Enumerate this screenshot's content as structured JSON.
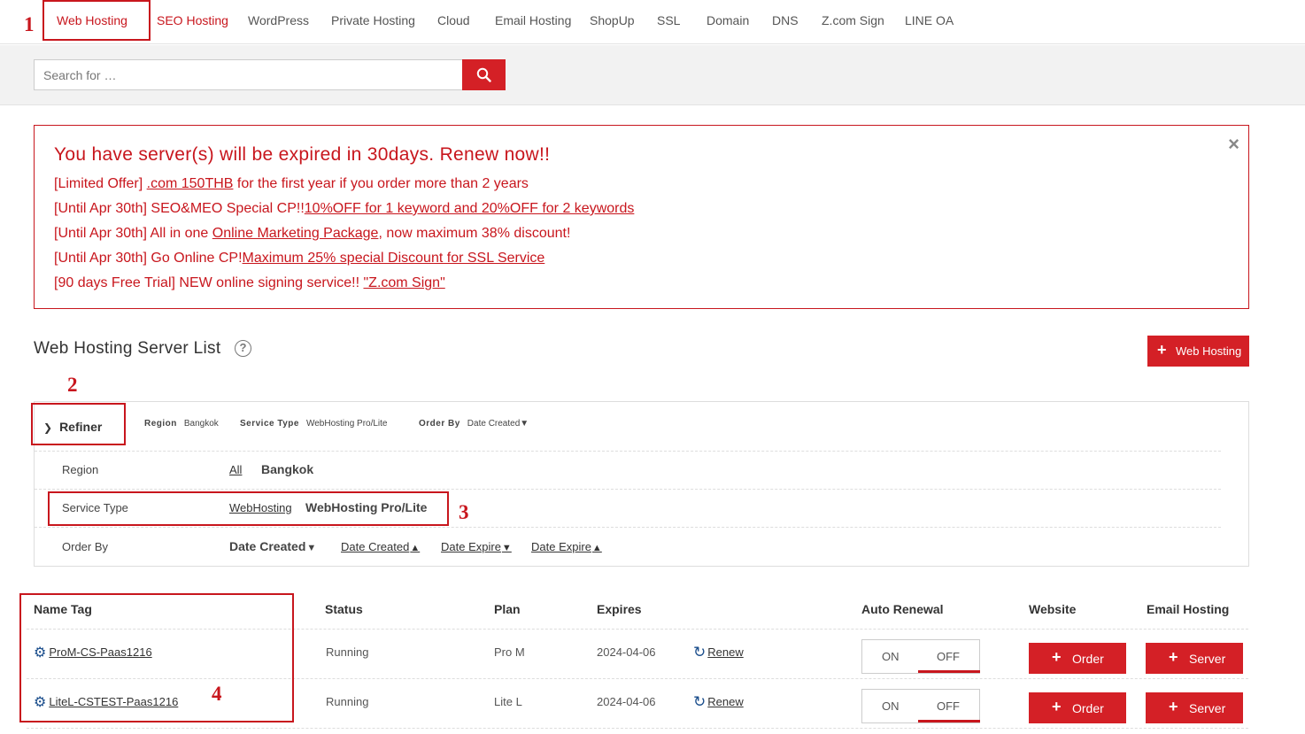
{
  "annotations": {
    "n1": "1",
    "n2": "2",
    "n3": "3",
    "n4": "4"
  },
  "nav": [
    {
      "label": "Web Hosting"
    },
    {
      "label": "SEO Hosting"
    },
    {
      "label": "WordPress"
    },
    {
      "label": "Private Hosting"
    },
    {
      "label": "Cloud"
    },
    {
      "label": "Email Hosting"
    },
    {
      "label": "ShopUp"
    },
    {
      "label": "SSL"
    },
    {
      "label": "Domain"
    },
    {
      "label": "DNS"
    },
    {
      "label": "Z.com Sign"
    },
    {
      "label": "LINE OA"
    }
  ],
  "search": {
    "placeholder": "Search for …"
  },
  "alert": {
    "title": "You have server(s) will be expired in 30days. Renew now!!",
    "close": "×",
    "lines": [
      {
        "prefix": "[Limited Offer] ",
        "link": ".com 150THB",
        "suffix": " for the first year if you order more than 2 years"
      },
      {
        "prefix": "[Until Apr 30th] SEO&MEO Special CP!!",
        "link": "10%OFF for 1 keyword and 20%OFF for 2 keywords",
        "suffix": ""
      },
      {
        "prefix": "[Until Apr 30th] All in one ",
        "link": "Online Marketing Package",
        "suffix": ", now maximum 38% discount!"
      },
      {
        "prefix": "[Until Apr 30th] Go Online CP!",
        "link": "Maximum 25% special Discount for SSL Service",
        "suffix": ""
      },
      {
        "prefix": "[90 days Free Trial] NEW online signing service!! ",
        "link": "\"Z.com Sign\"",
        "suffix": ""
      }
    ]
  },
  "section": {
    "title": "Web Hosting Server List",
    "help": "?",
    "add_button": "Web Hosting"
  },
  "refiner": {
    "toggle_label": "Refiner",
    "summary": [
      {
        "key": "Region",
        "value": "Bangkok"
      },
      {
        "key": "Service Type",
        "value": "WebHosting Pro/Lite"
      },
      {
        "key": "Order By",
        "value": "Date Created▼"
      }
    ],
    "rows": {
      "region": {
        "label": "Region",
        "options": [
          "All",
          "Bangkok"
        ]
      },
      "service_type": {
        "label": "Service Type",
        "options": [
          "WebHosting",
          "WebHosting Pro/Lite"
        ]
      },
      "order_by": {
        "label": "Order By",
        "options": [
          "Date Created",
          "Date Created",
          "Date Expire",
          "Date Expire"
        ]
      }
    }
  },
  "table": {
    "headers": [
      "Name Tag",
      "Status",
      "Plan",
      "Expires",
      "Auto Renewal",
      "Website",
      "Email Hosting"
    ],
    "renew_label": "Renew",
    "toggle_on": "ON",
    "toggle_off": "OFF",
    "order_label": "Order",
    "server_label": "Server",
    "rows": [
      {
        "name": "ProM-CS-Paas1216",
        "status": "Running",
        "plan": "Pro M",
        "expires": "2024-04-06",
        "auto_renewal": "OFF"
      },
      {
        "name": "LiteL-CSTEST-Paas1216",
        "status": "Running",
        "plan": "Lite L",
        "expires": "2024-04-06",
        "auto_renewal": "OFF"
      }
    ]
  },
  "colors": {
    "accent": "#d42026",
    "annotation": "#c8161d"
  }
}
